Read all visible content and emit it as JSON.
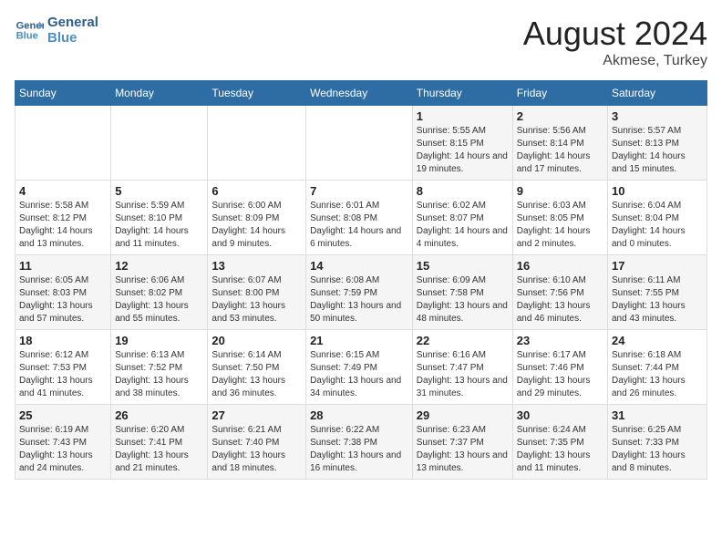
{
  "header": {
    "logo_line1": "General",
    "logo_line2": "Blue",
    "month_year": "August 2024",
    "location": "Akmese, Turkey"
  },
  "weekdays": [
    "Sunday",
    "Monday",
    "Tuesday",
    "Wednesday",
    "Thursday",
    "Friday",
    "Saturday"
  ],
  "weeks": [
    [
      {
        "day": "",
        "sunrise": "",
        "sunset": "",
        "daylight": ""
      },
      {
        "day": "",
        "sunrise": "",
        "sunset": "",
        "daylight": ""
      },
      {
        "day": "",
        "sunrise": "",
        "sunset": "",
        "daylight": ""
      },
      {
        "day": "",
        "sunrise": "",
        "sunset": "",
        "daylight": ""
      },
      {
        "day": "1",
        "sunrise": "5:55 AM",
        "sunset": "8:15 PM",
        "daylight": "14 hours and 19 minutes."
      },
      {
        "day": "2",
        "sunrise": "5:56 AM",
        "sunset": "8:14 PM",
        "daylight": "14 hours and 17 minutes."
      },
      {
        "day": "3",
        "sunrise": "5:57 AM",
        "sunset": "8:13 PM",
        "daylight": "14 hours and 15 minutes."
      }
    ],
    [
      {
        "day": "4",
        "sunrise": "5:58 AM",
        "sunset": "8:12 PM",
        "daylight": "14 hours and 13 minutes."
      },
      {
        "day": "5",
        "sunrise": "5:59 AM",
        "sunset": "8:10 PM",
        "daylight": "14 hours and 11 minutes."
      },
      {
        "day": "6",
        "sunrise": "6:00 AM",
        "sunset": "8:09 PM",
        "daylight": "14 hours and 9 minutes."
      },
      {
        "day": "7",
        "sunrise": "6:01 AM",
        "sunset": "8:08 PM",
        "daylight": "14 hours and 6 minutes."
      },
      {
        "day": "8",
        "sunrise": "6:02 AM",
        "sunset": "8:07 PM",
        "daylight": "14 hours and 4 minutes."
      },
      {
        "day": "9",
        "sunrise": "6:03 AM",
        "sunset": "8:05 PM",
        "daylight": "14 hours and 2 minutes."
      },
      {
        "day": "10",
        "sunrise": "6:04 AM",
        "sunset": "8:04 PM",
        "daylight": "14 hours and 0 minutes."
      }
    ],
    [
      {
        "day": "11",
        "sunrise": "6:05 AM",
        "sunset": "8:03 PM",
        "daylight": "13 hours and 57 minutes."
      },
      {
        "day": "12",
        "sunrise": "6:06 AM",
        "sunset": "8:02 PM",
        "daylight": "13 hours and 55 minutes."
      },
      {
        "day": "13",
        "sunrise": "6:07 AM",
        "sunset": "8:00 PM",
        "daylight": "13 hours and 53 minutes."
      },
      {
        "day": "14",
        "sunrise": "6:08 AM",
        "sunset": "7:59 PM",
        "daylight": "13 hours and 50 minutes."
      },
      {
        "day": "15",
        "sunrise": "6:09 AM",
        "sunset": "7:58 PM",
        "daylight": "13 hours and 48 minutes."
      },
      {
        "day": "16",
        "sunrise": "6:10 AM",
        "sunset": "7:56 PM",
        "daylight": "13 hours and 46 minutes."
      },
      {
        "day": "17",
        "sunrise": "6:11 AM",
        "sunset": "7:55 PM",
        "daylight": "13 hours and 43 minutes."
      }
    ],
    [
      {
        "day": "18",
        "sunrise": "6:12 AM",
        "sunset": "7:53 PM",
        "daylight": "13 hours and 41 minutes."
      },
      {
        "day": "19",
        "sunrise": "6:13 AM",
        "sunset": "7:52 PM",
        "daylight": "13 hours and 38 minutes."
      },
      {
        "day": "20",
        "sunrise": "6:14 AM",
        "sunset": "7:50 PM",
        "daylight": "13 hours and 36 minutes."
      },
      {
        "day": "21",
        "sunrise": "6:15 AM",
        "sunset": "7:49 PM",
        "daylight": "13 hours and 34 minutes."
      },
      {
        "day": "22",
        "sunrise": "6:16 AM",
        "sunset": "7:47 PM",
        "daylight": "13 hours and 31 minutes."
      },
      {
        "day": "23",
        "sunrise": "6:17 AM",
        "sunset": "7:46 PM",
        "daylight": "13 hours and 29 minutes."
      },
      {
        "day": "24",
        "sunrise": "6:18 AM",
        "sunset": "7:44 PM",
        "daylight": "13 hours and 26 minutes."
      }
    ],
    [
      {
        "day": "25",
        "sunrise": "6:19 AM",
        "sunset": "7:43 PM",
        "daylight": "13 hours and 24 minutes."
      },
      {
        "day": "26",
        "sunrise": "6:20 AM",
        "sunset": "7:41 PM",
        "daylight": "13 hours and 21 minutes."
      },
      {
        "day": "27",
        "sunrise": "6:21 AM",
        "sunset": "7:40 PM",
        "daylight": "13 hours and 18 minutes."
      },
      {
        "day": "28",
        "sunrise": "6:22 AM",
        "sunset": "7:38 PM",
        "daylight": "13 hours and 16 minutes."
      },
      {
        "day": "29",
        "sunrise": "6:23 AM",
        "sunset": "7:37 PM",
        "daylight": "13 hours and 13 minutes."
      },
      {
        "day": "30",
        "sunrise": "6:24 AM",
        "sunset": "7:35 PM",
        "daylight": "13 hours and 11 minutes."
      },
      {
        "day": "31",
        "sunrise": "6:25 AM",
        "sunset": "7:33 PM",
        "daylight": "13 hours and 8 minutes."
      }
    ]
  ],
  "labels": {
    "sunrise": "Sunrise:",
    "sunset": "Sunset:",
    "daylight": "Daylight:"
  }
}
